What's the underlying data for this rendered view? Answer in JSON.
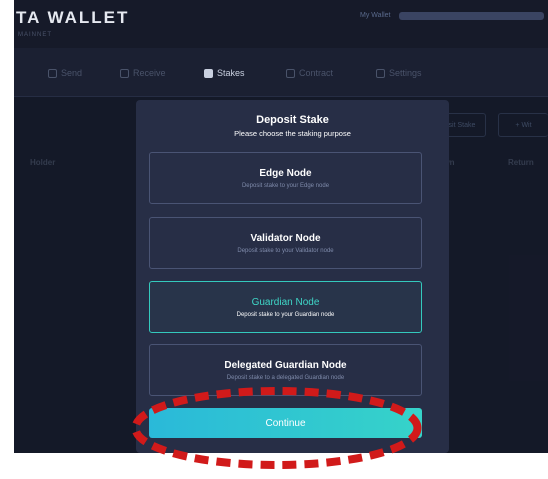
{
  "app": {
    "logo": "TA WALLET",
    "logo_sub": "MAINNET",
    "my_wallet_label": "My Wallet"
  },
  "nav": {
    "items": [
      {
        "label": "Send",
        "icon": "send-icon"
      },
      {
        "label": "Receive",
        "icon": "receive-icon"
      },
      {
        "label": "Stakes",
        "icon": "stakes-icon",
        "active": true
      },
      {
        "label": "Contract",
        "icon": "contract-icon"
      },
      {
        "label": "Settings",
        "icon": "settings-icon"
      }
    ]
  },
  "background": {
    "deposit_stake_button": "osit Stake",
    "withdraw_button": "+ Wit",
    "columns": [
      "Holder",
      "awn",
      "Return"
    ]
  },
  "modal": {
    "title": "Deposit Stake",
    "subtitle": "Please choose the staking purpose",
    "options": [
      {
        "title": "Edge Node",
        "description": "Deposit stake to your Edge node"
      },
      {
        "title": "Validator Node",
        "description": "Deposit stake to your Validator node"
      },
      {
        "title": "Guardian Node",
        "description": "Deposit stake to your Guardian node",
        "selected": true
      },
      {
        "title": "Delegated Guardian Node",
        "description": "Deposit stake to a delegated Guardian node"
      }
    ],
    "continue_label": "Continue"
  },
  "colors": {
    "accent": "#36d3c9",
    "highlight": "#d11a1a",
    "modal_bg": "#272e46",
    "app_bg": "#1b2032"
  }
}
